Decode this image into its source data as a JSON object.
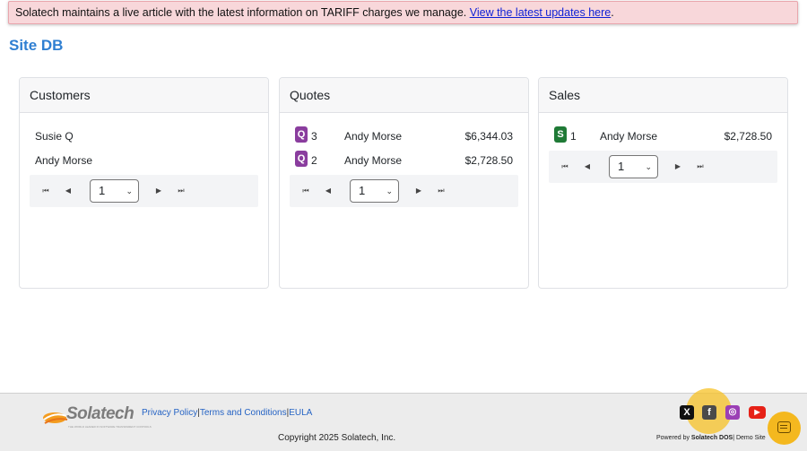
{
  "banner": {
    "text": "Solatech maintains a live article with the latest information on TARIFF charges we manage. ",
    "link": "View the latest updates here",
    "suffix": "."
  },
  "site_title": "Site DB",
  "customers": {
    "title": "Customers",
    "rows": [
      {
        "name": "Susie Q"
      },
      {
        "name": "Andy Morse"
      }
    ],
    "page": "1"
  },
  "quotes": {
    "title": "Quotes",
    "rows": [
      {
        "badge": "Q",
        "num": "3",
        "name": "Andy Morse",
        "amount": "$6,344.03"
      },
      {
        "badge": "Q",
        "num": "2",
        "name": "Andy Morse",
        "amount": "$2,728.50"
      }
    ],
    "page": "1"
  },
  "sales": {
    "title": "Sales",
    "rows": [
      {
        "badge": "S",
        "num": "1",
        "name": "Andy Morse",
        "amount": "$2,728.50"
      }
    ],
    "page": "1"
  },
  "pager_icons": {
    "first": "⏮",
    "prev": "◀",
    "next": "▶",
    "last": "⏭",
    "chevron": "⌄"
  },
  "footer": {
    "logo": "Solatech",
    "logo_tagline": "THE WORLD LEADER IN SOFTWARE TRANSPARENT CONTROLS",
    "privacy": "Privacy Policy",
    "terms": "Terms and Conditions",
    "eula": "EULA",
    "sep": "|",
    "copyright": "Copyright 2025 Solatech, Inc.",
    "powered_prefix": "Powered by ",
    "powered_brand": "Solatech DOS",
    "powered_suffix": "| Demo Site",
    "social": {
      "x": "X",
      "facebook": "f",
      "instagram": "◎",
      "youtube": "▶"
    }
  },
  "colors": {
    "banner_bg": "#f8d7da",
    "title_blue": "#2f7fd2",
    "quote_badge": "#8a3d9e",
    "sale_badge": "#1f7a36",
    "highlight": "#f7c226",
    "youtube": "#e62117",
    "instagram": "#9b3fb5"
  }
}
